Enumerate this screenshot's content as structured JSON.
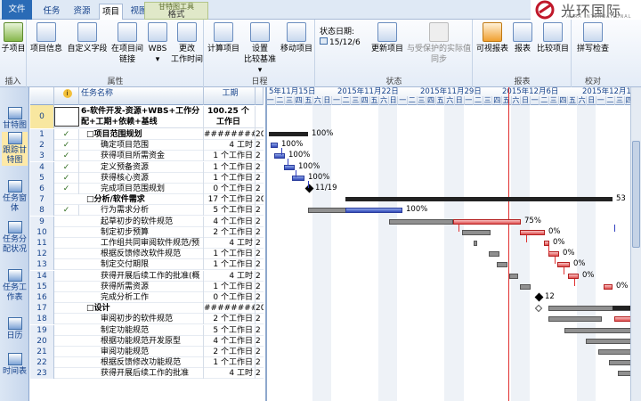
{
  "tabs": {
    "file": "文件",
    "task": "任务",
    "resource": "资源",
    "project": "项目",
    "view": "视图",
    "format": "格式"
  },
  "tool_tab": "甘特图工具",
  "brand": {
    "name": "光环国际",
    "sub": "AURA INTERNATIONAL"
  },
  "ribbon": {
    "insert": {
      "label": "插入",
      "subproject": "子项目"
    },
    "props": {
      "label": "属性",
      "info": "项目信息",
      "custom": "自定义字段",
      "links1": "在项目间",
      "links2": "链接",
      "wbs": "WBS",
      "change1": "更改",
      "change2": "工作时间"
    },
    "schedule": {
      "label": "日程",
      "calc": "计算项目",
      "baseline1": "设置",
      "baseline2": "比较基准",
      "move": "移动项目"
    },
    "status": {
      "label": "状态",
      "status_date_label": "状态日期:",
      "status_date": "15/12/6",
      "update": "更新项目",
      "sync1": "与受保护的实际值",
      "sync2": "同步"
    },
    "reports": {
      "label": "报表",
      "visual": "可视报表",
      "report": "报表",
      "compare": "比较项目"
    },
    "proof": {
      "label": "校对",
      "spell": "拼写检查"
    }
  },
  "nav": [
    "甘特图",
    "跟踪甘特图",
    "任务窗体",
    "任务分配状况",
    "任务工作表",
    "日历",
    "时间表"
  ],
  "sheet": {
    "headers": {
      "id": "",
      "info": "",
      "name": "任务名称",
      "duration": "工期",
      "start": ""
    },
    "row0": {
      "id": "0",
      "name": "6-软件开发-资源+WBS+工作分配+工期+依赖+基线",
      "duration": "100.25 个工作日"
    },
    "rows": [
      {
        "id": "1",
        "chk": "✓",
        "name": "□项目范围规划",
        "dur": "##########",
        "st": "20",
        "bold": true
      },
      {
        "id": "2",
        "chk": "✓",
        "name": "确定项目范围",
        "dur": "4 工时",
        "st": "2"
      },
      {
        "id": "3",
        "chk": "✓",
        "name": "获得项目所需资金",
        "dur": "1 个工作日",
        "st": "2"
      },
      {
        "id": "4",
        "chk": "✓",
        "name": "定义预备资源",
        "dur": "1 个工作日",
        "st": "2"
      },
      {
        "id": "5",
        "chk": "✓",
        "name": "获得核心资源",
        "dur": "1 个工作日",
        "st": "2"
      },
      {
        "id": "6",
        "chk": "✓",
        "name": "完成项目范围规划",
        "dur": "0 个工作日",
        "st": "2"
      },
      {
        "id": "7",
        "chk": "",
        "name": "□分析/软件需求",
        "dur": "17 个工作日",
        "st": "20",
        "bold": true
      },
      {
        "id": "8",
        "chk": "✓",
        "name": "行为需求分析",
        "dur": "5 个工作日",
        "st": "2"
      },
      {
        "id": "9",
        "chk": "",
        "name": "起草初步的软件规范",
        "dur": "4 个工作日",
        "st": "2"
      },
      {
        "id": "10",
        "chk": "",
        "name": "制定初步预算",
        "dur": "2 个工作日",
        "st": "2"
      },
      {
        "id": "11",
        "chk": "",
        "name": "工作组共同审阅软件规范/预",
        "dur": "4 工时",
        "st": "2"
      },
      {
        "id": "12",
        "chk": "",
        "name": "根据反馈修改软件规范",
        "dur": "1 个工作日",
        "st": "2"
      },
      {
        "id": "13",
        "chk": "",
        "name": "制定交付期限",
        "dur": "1 个工作日",
        "st": "2"
      },
      {
        "id": "14",
        "chk": "",
        "name": "获得开展后续工作的批准(概",
        "dur": "4 工时",
        "st": "2"
      },
      {
        "id": "15",
        "chk": "",
        "name": "获得所需资源",
        "dur": "1 个工作日",
        "st": "2"
      },
      {
        "id": "16",
        "chk": "",
        "name": "完成分析工作",
        "dur": "0 个工作日",
        "st": "2"
      },
      {
        "id": "17",
        "chk": "",
        "name": "□设计",
        "dur": "##########",
        "st": "20",
        "bold": true
      },
      {
        "id": "18",
        "chk": "",
        "name": "审阅初步的软件规范",
        "dur": "2 个工作日",
        "st": "2"
      },
      {
        "id": "19",
        "chk": "",
        "name": "制定功能规范",
        "dur": "5 个工作日",
        "st": "2"
      },
      {
        "id": "20",
        "chk": "",
        "name": "根据功能规范开发原型",
        "dur": "4 个工作日",
        "st": "2"
      },
      {
        "id": "21",
        "chk": "",
        "name": "审阅功能规范",
        "dur": "2 个工作日",
        "st": "2"
      },
      {
        "id": "22",
        "chk": "",
        "name": "根据反馈修改功能规范",
        "dur": "1 个工作日",
        "st": "2"
      },
      {
        "id": "23",
        "chk": "",
        "name": "获得开展后续工作的批准",
        "dur": "4 工时",
        "st": "2"
      }
    ]
  },
  "gantt": {
    "weeks": [
      "5年11月15日",
      "2015年11月22日",
      "2015年11月29日",
      "2015年12月6日",
      "2015年12月13日"
    ],
    "day_letters": [
      "一",
      "二",
      "三",
      "四",
      "五",
      "六",
      "日"
    ],
    "labels": {
      "r1": "100%",
      "r2": "100%",
      "r3": "100%",
      "r4": "100%",
      "r5": "100%",
      "r6": "11/19",
      "r7": "53",
      "r8": "100%",
      "r9": "75%",
      "r10": "0%",
      "r11": "0%",
      "r12": "0%",
      "r13": "0%",
      "r14": "0%",
      "r15": "0%",
      "r16": "12"
    },
    "colors": {
      "complete": "#3148b8",
      "critical": "#e05050",
      "baseline": "#909090",
      "status_line": "#e03030"
    }
  }
}
